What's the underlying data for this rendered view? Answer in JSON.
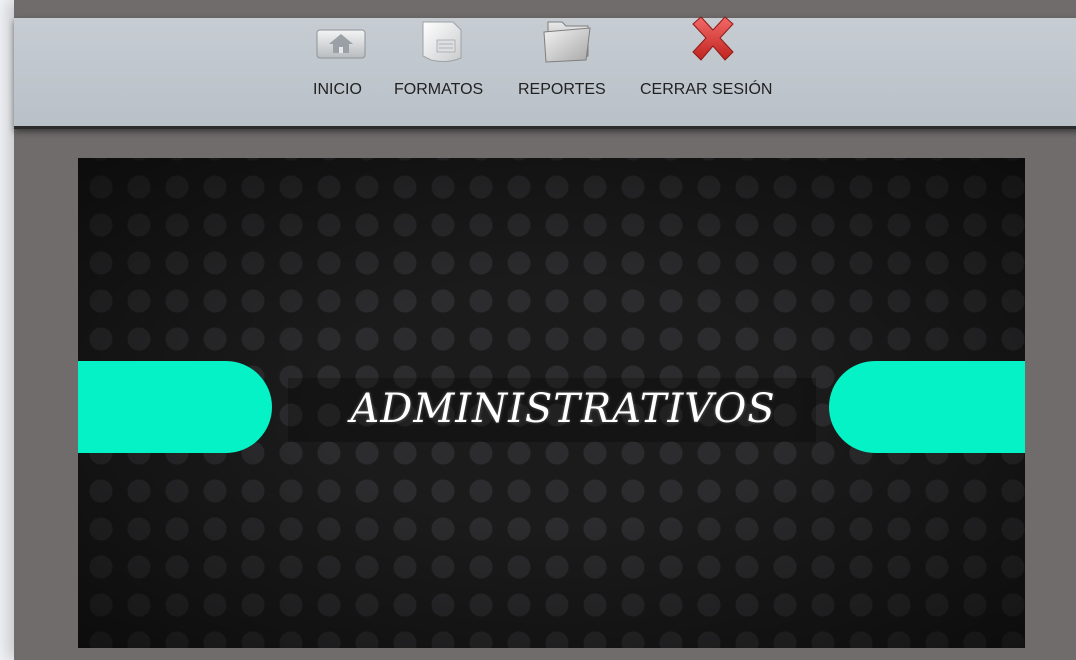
{
  "nav": {
    "items": [
      {
        "label": "INICIO",
        "icon": "home-icon"
      },
      {
        "label": "FORMATOS",
        "icon": "document-icon"
      },
      {
        "label": "REPORTES",
        "icon": "folder-icon"
      },
      {
        "label": "CERRAR SESIÓN",
        "icon": "close-icon"
      }
    ]
  },
  "banner": {
    "title": "ADMINISTRATIVOS"
  },
  "colors": {
    "accent": "#04f2c6",
    "nav_background": "#bfc6cc",
    "banner_background": "#1b1b1b",
    "logout_icon": "#d8302f"
  }
}
